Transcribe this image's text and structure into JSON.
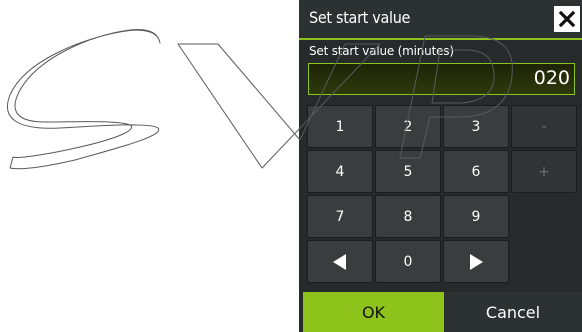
{
  "dialog": {
    "title": "Set start value",
    "close_icon": "close-icon"
  },
  "field": {
    "label": "Set start value (minutes)",
    "value": "020"
  },
  "keypad": {
    "keys": [
      {
        "label": "1",
        "enabled": true
      },
      {
        "label": "2",
        "enabled": true
      },
      {
        "label": "3",
        "enabled": true
      },
      {
        "label": "-",
        "enabled": false
      },
      {
        "label": "4",
        "enabled": true
      },
      {
        "label": "5",
        "enabled": true
      },
      {
        "label": "6",
        "enabled": true
      },
      {
        "label": "+",
        "enabled": false
      },
      {
        "label": "7",
        "enabled": true
      },
      {
        "label": "8",
        "enabled": true
      },
      {
        "label": "9",
        "enabled": true
      },
      {
        "icon": "arrow-left-icon",
        "enabled": true
      },
      {
        "label": "0",
        "enabled": true
      },
      {
        "icon": "arrow-right-icon",
        "enabled": true
      }
    ]
  },
  "buttons": {
    "ok_label": "OK",
    "cancel_label": "Cancel"
  },
  "watermark": {
    "text": "SVP"
  },
  "colors": {
    "accent": "#8dc31a",
    "panel": "#262a2b",
    "key": "#393d3e",
    "text": "#ffffff"
  }
}
